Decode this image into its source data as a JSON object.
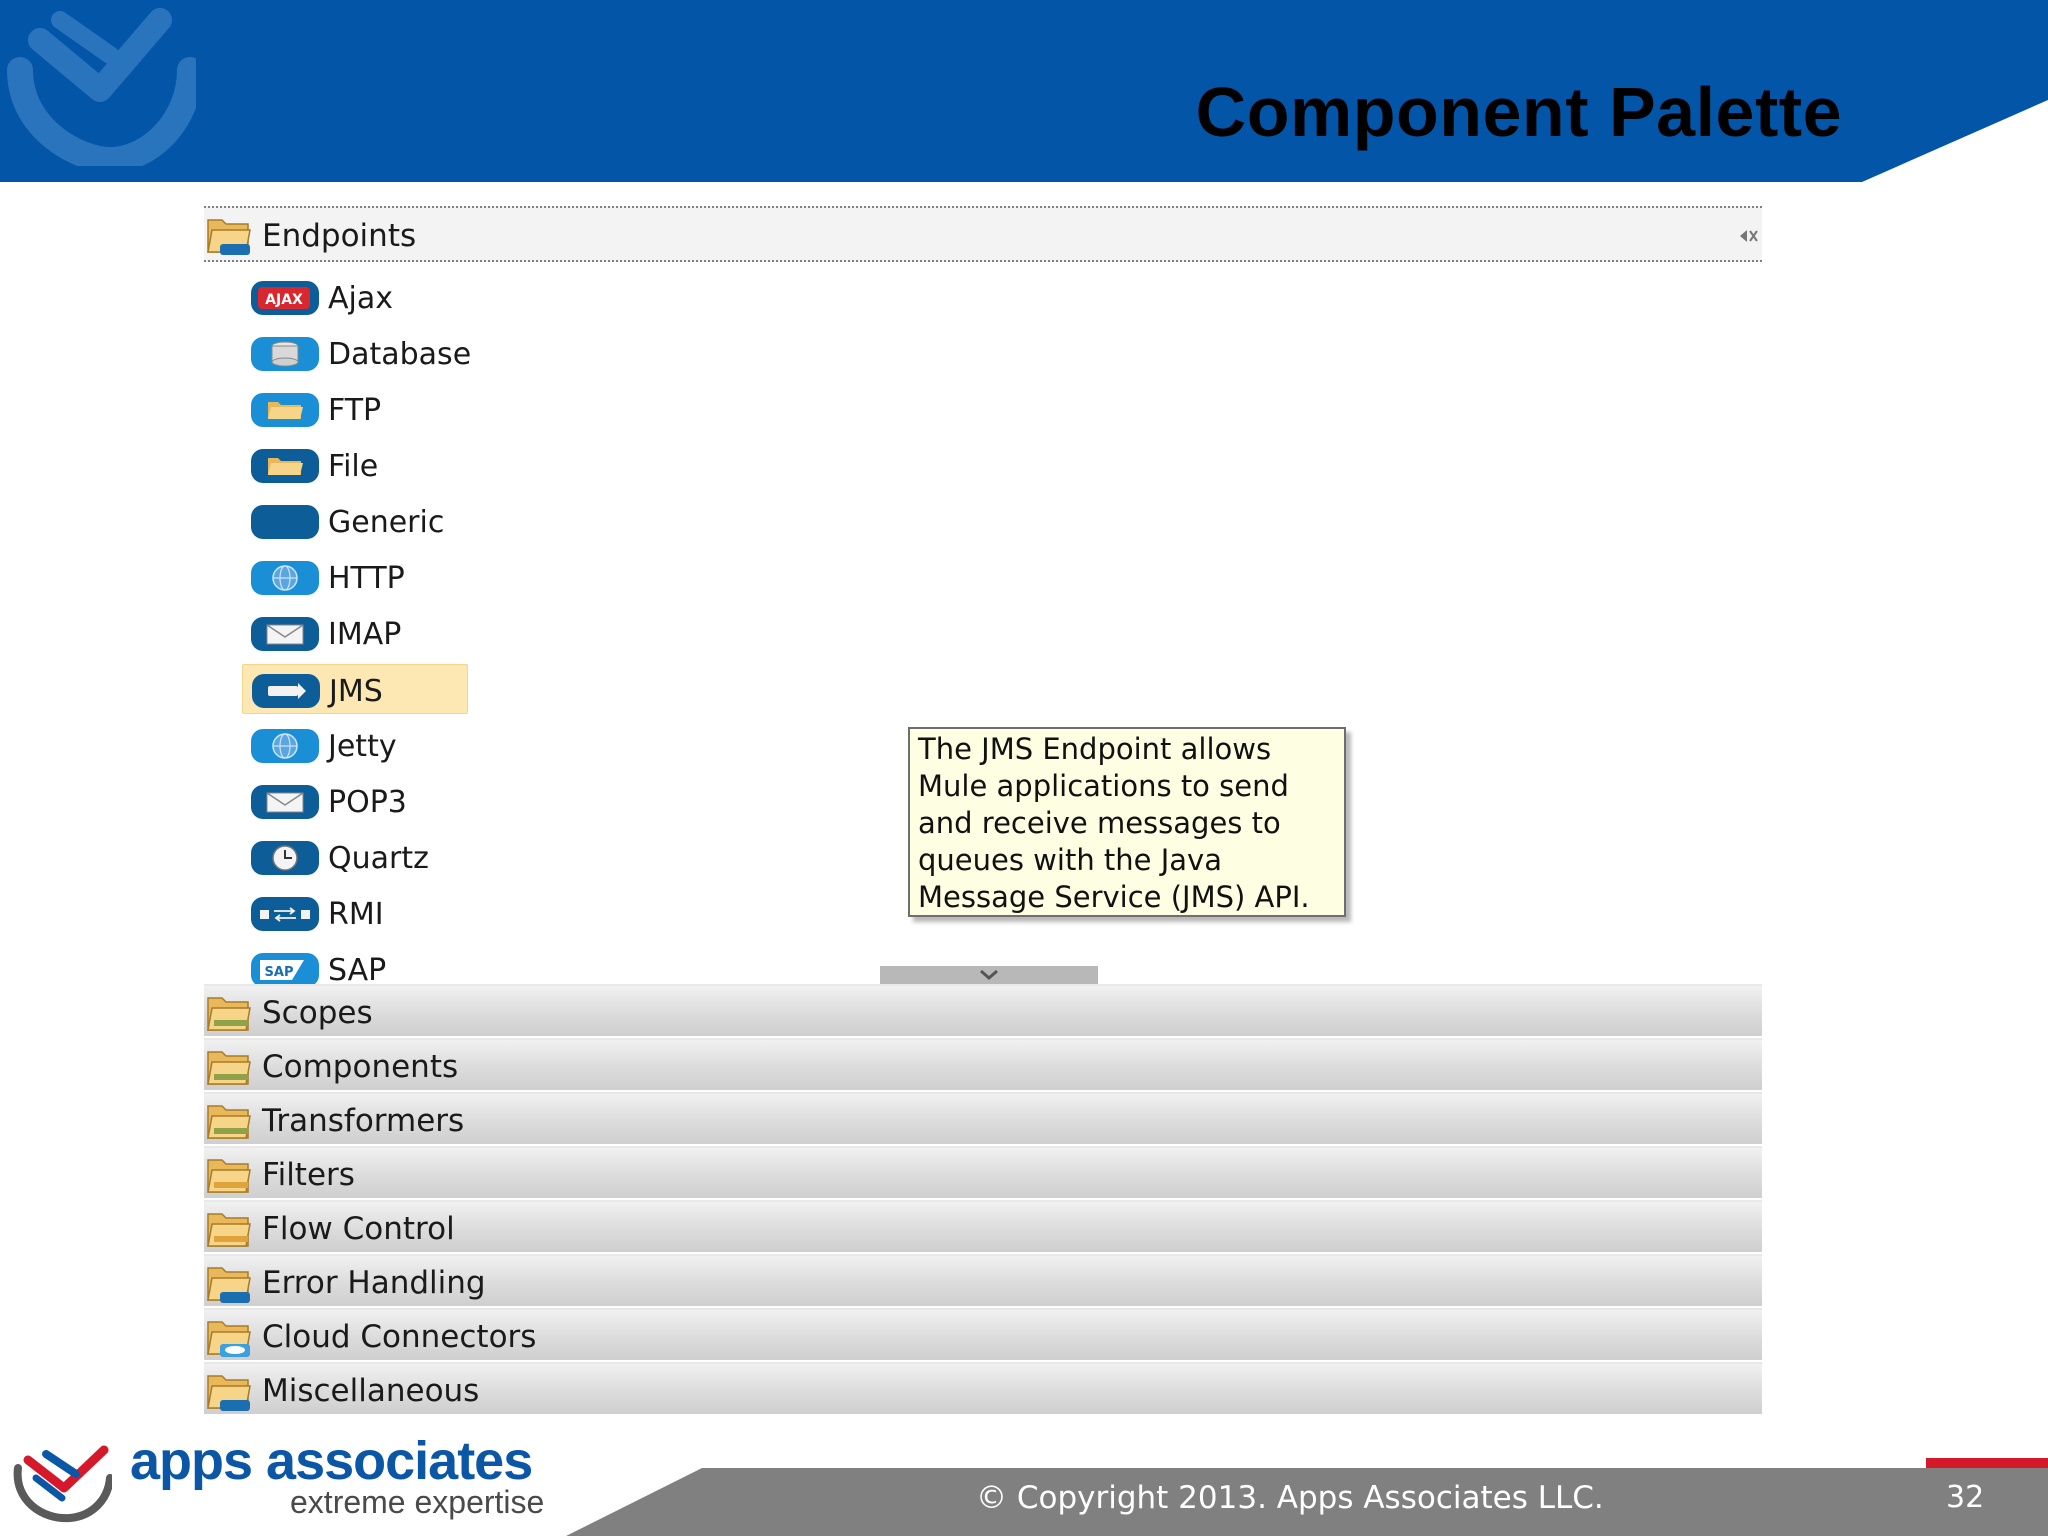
{
  "slide": {
    "title": "Component Palette",
    "copyright": "© Copyright 2013. Apps Associates LLC.",
    "page_number": "32"
  },
  "brand": {
    "name": "apps associates",
    "tagline": "extreme expertise",
    "primary_color": "#0356a7",
    "accent_color": "#d6192a"
  },
  "palette": {
    "open_drawer": {
      "label": "Endpoints",
      "icon": "folder-icon"
    },
    "items": [
      {
        "label": "Ajax",
        "icon": "ajax-icon"
      },
      {
        "label": "Database",
        "icon": "database-icon"
      },
      {
        "label": "FTP",
        "icon": "folder-icon"
      },
      {
        "label": "File",
        "icon": "folder-icon"
      },
      {
        "label": "Generic",
        "icon": "generic-icon"
      },
      {
        "label": "HTTP",
        "icon": "globe-icon"
      },
      {
        "label": "IMAP",
        "icon": "envelope-icon"
      },
      {
        "label": "JMS",
        "icon": "jms-icon",
        "selected": true
      },
      {
        "label": "Jetty",
        "icon": "globe-icon"
      },
      {
        "label": "POP3",
        "icon": "envelope-icon"
      },
      {
        "label": "Quartz",
        "icon": "clock-icon"
      },
      {
        "label": "RMI",
        "icon": "rmi-icon"
      },
      {
        "label": "SAP",
        "icon": "sap-icon"
      }
    ],
    "closed_drawers": [
      {
        "label": "Scopes"
      },
      {
        "label": "Components"
      },
      {
        "label": "Transformers"
      },
      {
        "label": "Filters"
      },
      {
        "label": "Flow Control"
      },
      {
        "label": "Error Handling"
      },
      {
        "label": "Cloud Connectors"
      },
      {
        "label": "Miscellaneous"
      }
    ]
  },
  "tooltip": {
    "text": "The JMS Endpoint allows\nMule applications to send\nand receive messages to\nqueues with the Java\nMessage Service (JMS) API."
  }
}
